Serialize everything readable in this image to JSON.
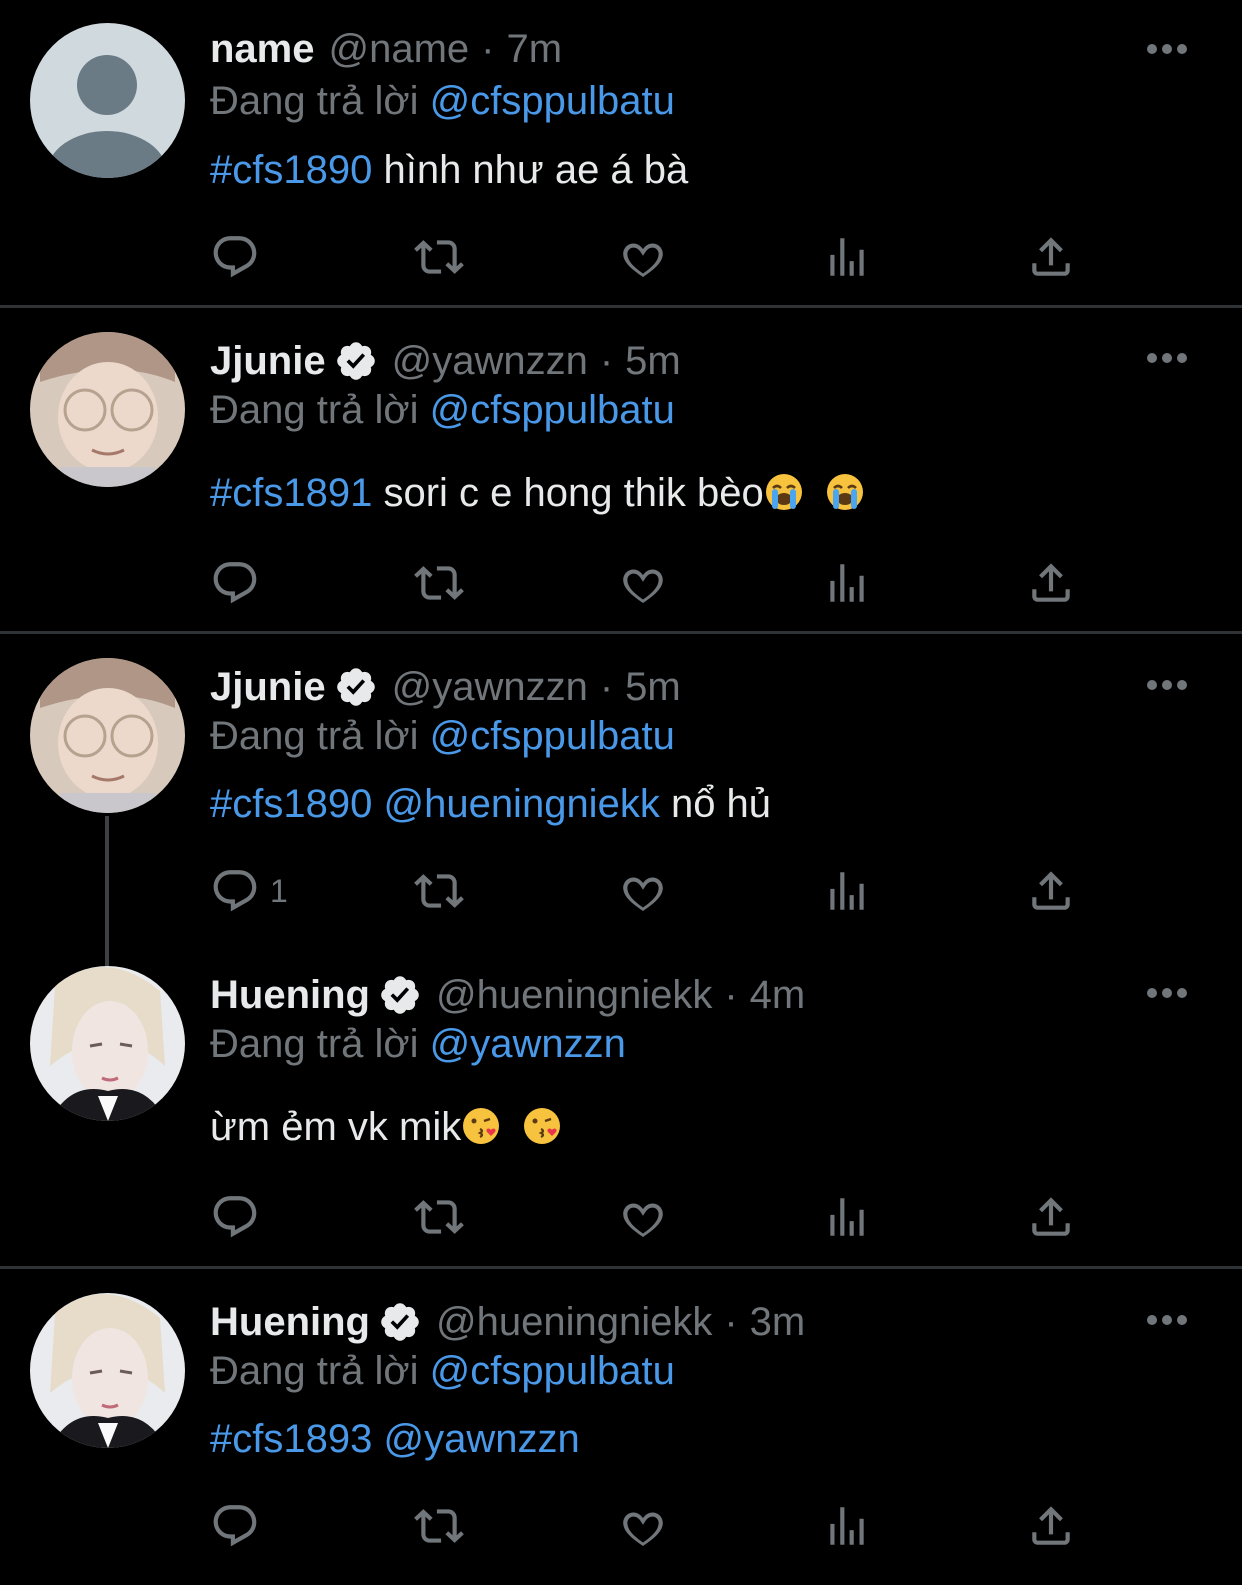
{
  "reply_prefix": "Đang trả lời",
  "tweets": [
    {
      "name": "name",
      "verified": false,
      "handle": "@name",
      "separator": "·",
      "time": "7m",
      "reply_to": "@cfsppulbatu",
      "text_link": "#cfs1890",
      "text_link2": "",
      "text": "hình như ae á bà",
      "reply_count": ""
    },
    {
      "name": "Jjunie",
      "verified": true,
      "handle": "@yawnzzn",
      "separator": "·",
      "time": "5m",
      "reply_to": "@cfsppulbatu",
      "text_link": "#cfs1891",
      "text_link2": "",
      "text": "sori c e hong thik bèo",
      "emoji": "loudly-crying-face",
      "reply_count": ""
    },
    {
      "name": "Jjunie",
      "verified": true,
      "handle": "@yawnzzn",
      "separator": "·",
      "time": "5m",
      "reply_to": "@cfsppulbatu",
      "text_link": "#cfs1890",
      "text_link2": "@hueningniekk",
      "text": "nổ hủ",
      "reply_count": "1"
    },
    {
      "name": "Huening",
      "verified": true,
      "handle": "@hueningniekk",
      "separator": "·",
      "time": "4m",
      "reply_to": "@yawnzzn",
      "text_link": "",
      "text_link2": "",
      "text": "ừm ẻm vk mik",
      "emoji": "face-blowing-kiss",
      "reply_count": ""
    },
    {
      "name": "Huening",
      "verified": true,
      "handle": "@hueningniekk",
      "separator": "·",
      "time": "3m",
      "reply_to": "@cfsppulbatu",
      "text_link": "#cfs1893",
      "text_link2": "@yawnzzn",
      "text": "",
      "reply_count": ""
    }
  ],
  "icons": [
    "reply-icon",
    "retweet-icon",
    "like-icon",
    "views-icon",
    "share-icon",
    "more-icon",
    "verified-badge-icon"
  ],
  "colors": {
    "background": "#000000",
    "text": "#e7e9ea",
    "muted": "#71767b",
    "link": "#4a99e9",
    "divider": "#2f3336"
  }
}
